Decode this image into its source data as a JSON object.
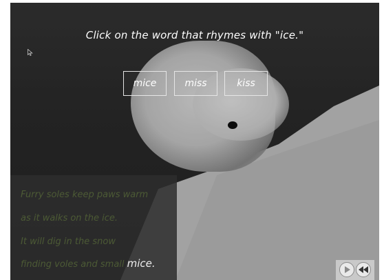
{
  "question": {
    "prompt": "Click on the word that rhymes with \"ice.\""
  },
  "choices": [
    {
      "label": "mice"
    },
    {
      "label": "miss"
    },
    {
      "label": "kiss"
    }
  ],
  "poem": {
    "line1": "Furry soles keep paws warm",
    "line2": "as it walks on the ice.",
    "line3": "It will dig in the snow",
    "line4_prefix": "finding voles and small",
    "line4_highlight": "mice."
  },
  "icons": {
    "cursor": "mouse-pointer-icon",
    "forward": "play-forward-icon",
    "back": "rewind-back-icon"
  },
  "colors": {
    "poem_text": "#4c5a35",
    "highlight_text": "#eeeeee",
    "choice_border": "#e6e6e6"
  }
}
